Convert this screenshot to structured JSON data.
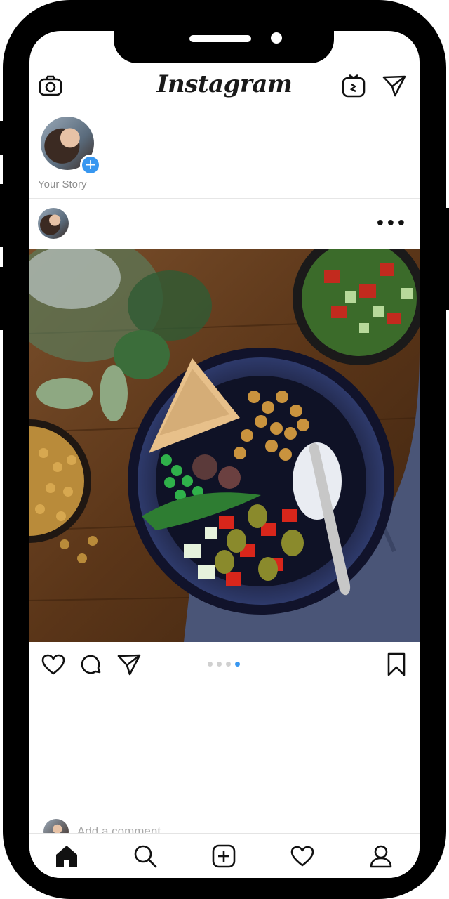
{
  "header": {
    "logo_text": "Instagram",
    "icons": [
      "camera-icon",
      "igtv-icon",
      "direct-message-icon"
    ]
  },
  "stories": {
    "items": [
      {
        "label": "Your Story",
        "badge_icon": "plus-icon"
      }
    ]
  },
  "post": {
    "more_icon": "more-dots-icon",
    "more_text": "•••",
    "actions": [
      "like-icon",
      "comment-icon",
      "share-icon",
      "bookmark-icon"
    ],
    "carousel": {
      "count": 4,
      "active_index": 3,
      "active_color": "#3897f0"
    },
    "comment_placeholder": "Add a comment..."
  },
  "bottom_nav": {
    "items": [
      "home-icon",
      "search-icon",
      "new-post-icon",
      "activity-icon",
      "profile-icon"
    ]
  },
  "colors": {
    "accent": "#3897f0",
    "frame": "#000000",
    "text_secondary": "#8e8e8e"
  }
}
